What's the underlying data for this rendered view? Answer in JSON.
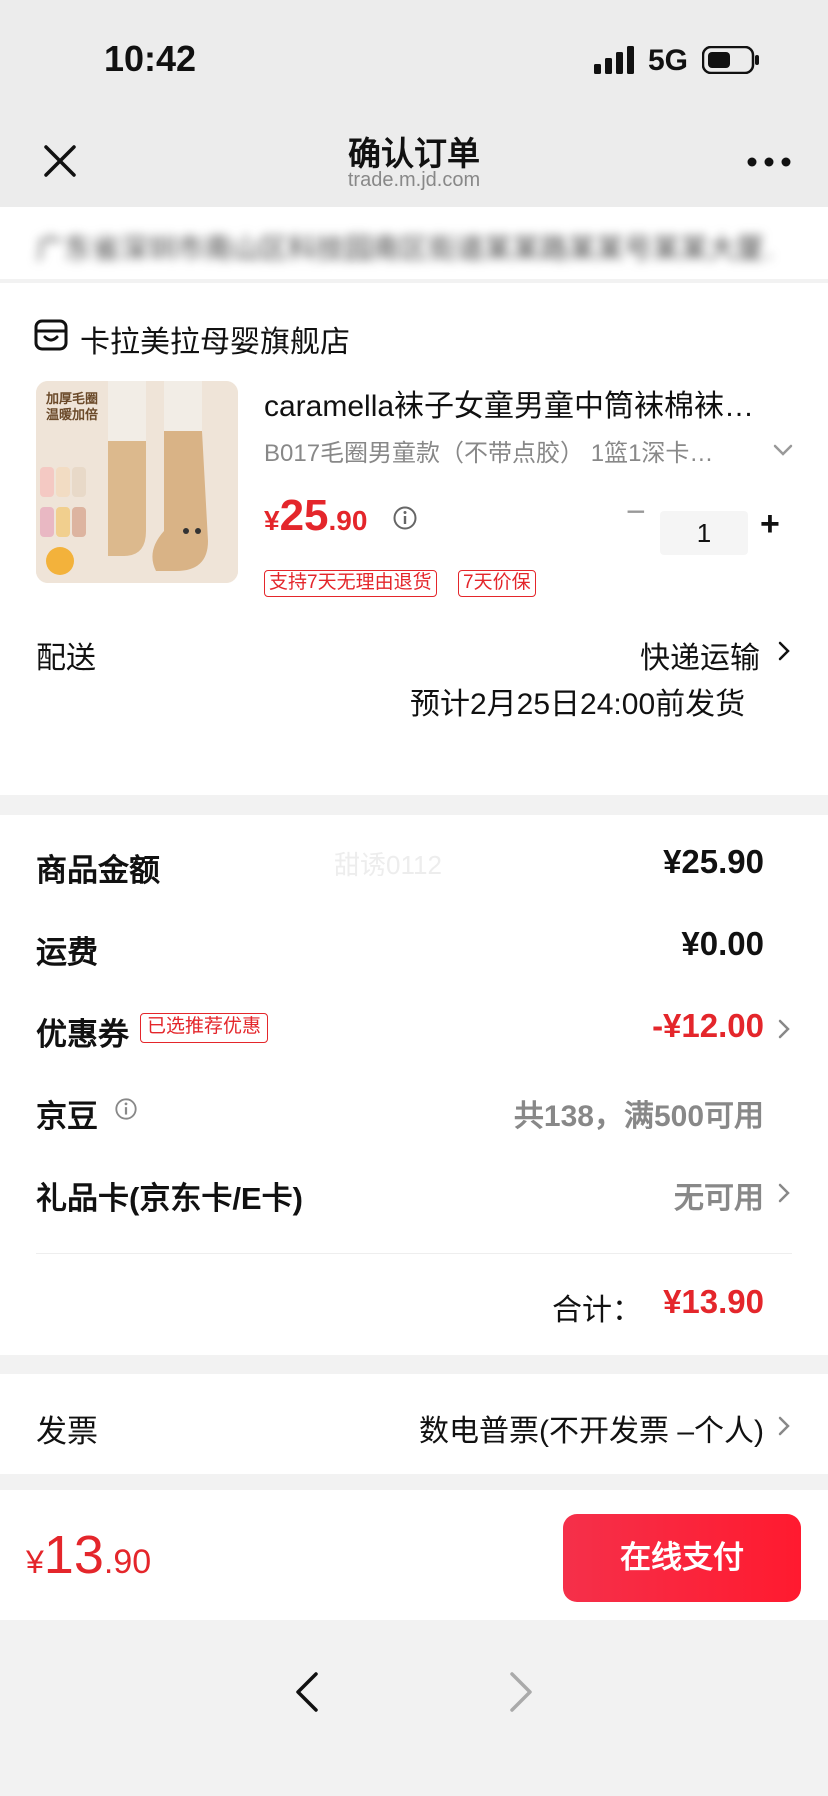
{
  "status_bar": {
    "time": "10:42",
    "network": "5G"
  },
  "nav": {
    "title": "确认订单",
    "subtitle": "trade.m.jd.com",
    "close_icon": "close-icon",
    "more_icon": "more-icon"
  },
  "address": {
    "masked_text": "广东省深圳市南山区科技园南区街道某某路某某号某某大厦…"
  },
  "shop": {
    "store_name": "卡拉美拉母婴旗舰店",
    "store_icon": "store-icon",
    "image_caption_1": "加厚毛圈",
    "image_caption_2": "温暖加倍",
    "product_title": "caramella袜子女童男童中筒袜棉袜…",
    "product_spec": "B017毛圈男童款（不带点胶） 1篮1深卡…",
    "price_symbol": "¥",
    "price_int": "25",
    "price_dec": ".90",
    "quantity": "1",
    "qty_minus": "−",
    "qty_plus": "+",
    "tags": [
      "支持7天无理由退货",
      "7天价保"
    ],
    "delivery_label": "配送",
    "delivery_method": "快递运输",
    "delivery_eta": "预计2月25日24:00前发货"
  },
  "summary": {
    "watermark": "甜诱0112",
    "rows": [
      {
        "label": "商品金额",
        "value": "¥25.90"
      },
      {
        "label": "运费",
        "value": "¥0.00"
      },
      {
        "label": "优惠券",
        "value": "-¥12.00",
        "tag": "已选推荐优惠"
      },
      {
        "label": "京豆",
        "value": "共138，满500可用"
      },
      {
        "label": "礼品卡(京东卡/E卡)",
        "value": "无可用"
      }
    ],
    "total_label": "合计：",
    "total_value": "¥13.90"
  },
  "invoice": {
    "label": "发票",
    "value": "数电普票(不开发票 –个人)"
  },
  "bottom": {
    "price_symbol": "¥",
    "price_int": "13",
    "price_dec": ".90",
    "pay_label": "在线支付"
  },
  "colors": {
    "accent": "#e4262b",
    "pay_button": "#f5304a",
    "background": "#f2f2f2"
  }
}
